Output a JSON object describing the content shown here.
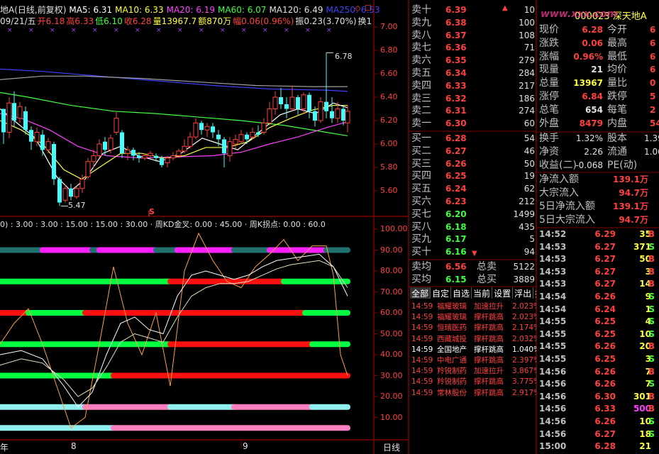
{
  "header": {
    "stock": "地A(日线,前复权)",
    "ma5": "MA5: 6.31",
    "ma10": "MA10: 6.33",
    "ma20": "MA20: 6.19",
    "ma60": "MA60: 6.07",
    "ma120": "MA120: 6.49",
    "ma250": "MA250: 6.53",
    "date": "09/21/五",
    "open": "开6.18",
    "high": "高6.33",
    "low": "低6.10",
    "close": "收6.28",
    "vol": "量13967.7",
    "amount": "额870万",
    "chg": "幅0.06(0.96%)",
    "amp": "振0.23(3.70%)",
    "turn": "换1"
  },
  "price_axis": [
    "7.00",
    "6.80",
    "6.60",
    "6.40",
    "6.20",
    "6.00",
    "5.80",
    "5.60"
  ],
  "price_marks": {
    "high_label": "6.78",
    "low_label": "5.47",
    "s_marker": "S"
  },
  "indicator_header": "0) : 3.00 : 3.00 : 15.00 : 15.00 : 30.00 · 周KD金叉: 0.00 : 45.00 · 周K拐点: 0.00 : 60.0",
  "ind_axis": [
    "100.00",
    "90.00",
    "80.00",
    "70.00",
    "60.00",
    "50.00",
    "40.00",
    "30.00",
    "20.00",
    "10.00"
  ],
  "bottom_bar": {
    "m1": "年",
    "m2": "8",
    "m3": "9",
    "period": "日线"
  },
  "orderbook": {
    "asks": [
      {
        "label": "卖十",
        "price": "6.39",
        "vol": "10"
      },
      {
        "label": "卖九",
        "price": "6.38",
        "vol": "100"
      },
      {
        "label": "卖八",
        "price": "6.37",
        "vol": "108"
      },
      {
        "label": "卖七",
        "price": "6.36",
        "vol": "71"
      },
      {
        "label": "卖六",
        "price": "6.35",
        "vol": "279"
      },
      {
        "label": "卖五",
        "price": "6.34",
        "vol": "284"
      },
      {
        "label": "卖四",
        "price": "6.33",
        "vol": "217"
      },
      {
        "label": "卖三",
        "price": "6.32",
        "vol": "186"
      },
      {
        "label": "卖二",
        "price": "6.31",
        "vol": "274"
      },
      {
        "label": "卖一",
        "price": "6.30",
        "vol": "60"
      }
    ],
    "bids": [
      {
        "label": "买一",
        "price": "6.28",
        "vol": "54"
      },
      {
        "label": "买二",
        "price": "6.27",
        "vol": "46"
      },
      {
        "label": "买三",
        "price": "6.26",
        "vol": "50"
      },
      {
        "label": "买四",
        "price": "6.25",
        "vol": "19"
      },
      {
        "label": "买五",
        "price": "6.24",
        "vol": "62"
      },
      {
        "label": "买六",
        "price": "6.23",
        "vol": "212"
      },
      {
        "label": "买七",
        "price": "6.20",
        "vol": "1499"
      },
      {
        "label": "买八",
        "price": "6.18",
        "vol": "435"
      },
      {
        "label": "买九",
        "price": "6.17",
        "vol": "5"
      },
      {
        "label": "买十",
        "price": "6.16",
        "vol": "94"
      }
    ],
    "avg_ask": {
      "label": "卖均",
      "price": "6.56",
      "tlabel": "总卖",
      "total": "5122"
    },
    "avg_bid": {
      "label": "买均",
      "price": "6.15",
      "tlabel": "总买",
      "total": "3889"
    }
  },
  "tabs": [
    "全部",
    "自定",
    "自选",
    "当前",
    "设置",
    "浮出",
    "执"
  ],
  "news": [
    {
      "time": "14:59",
      "name": "福耀玻璃",
      "sig": "加速拉升",
      "val": "2.023%",
      "color": "#ff4040"
    },
    {
      "time": "14:59",
      "name": "福耀玻璃",
      "sig": "撑杆跳高",
      "val": "2.023%",
      "color": "#ff4040"
    },
    {
      "time": "14:59",
      "name": "恒瑞医药",
      "sig": "撑杆跳高",
      "val": "2.174%",
      "color": "#ff4040"
    },
    {
      "time": "14:59",
      "name": "西藏城投",
      "sig": "撑杆跳高",
      "val": "2.032%",
      "color": "#ff4040"
    },
    {
      "time": "14:59",
      "name": "全国地产",
      "sig": "撑杆跳高",
      "val": "1.040%",
      "color": "#ffffff"
    },
    {
      "time": "14:59",
      "name": "中电广通",
      "sig": "撑杆跳高",
      "val": "2.397%",
      "color": "#ff4040"
    },
    {
      "time": "14:59",
      "name": "羚锐制药",
      "sig": "加速拉升",
      "val": "3.867%",
      "color": "#ff4040"
    },
    {
      "time": "14:59",
      "name": "羚锐制药",
      "sig": "撑杆跳高",
      "val": "3.775%",
      "color": "#ff4040"
    },
    {
      "time": "14:59",
      "name": "常林股份",
      "sig": "撑杆跳高",
      "val": "2.917%",
      "color": "#ff4040"
    }
  ],
  "stock_title": "000023 深天地A",
  "watermark": "www.xxx.com",
  "quote": [
    {
      "k1": "现价",
      "v1": "6.28",
      "c1": "#ff4040",
      "k2": "今开",
      "v2": "6"
    },
    {
      "k1": "涨跌",
      "v1": "0.06",
      "c1": "#ff4040",
      "k2": "最高",
      "v2": "6"
    },
    {
      "k1": "涨幅",
      "v1": "0.96%",
      "c1": "#ff4040",
      "k2": "最低",
      "v2": "6"
    },
    {
      "k1": "现量",
      "v1": "21",
      "c1": "#e0e0e0",
      "k2": "均价",
      "v2": "6"
    },
    {
      "k1": "总量",
      "v1": "13967",
      "c1": "#ffff40",
      "k2": "量比",
      "v2": "0"
    },
    {
      "k1": "涨停",
      "v1": "6.84",
      "c1": "#ff4040",
      "k2": "跌停",
      "v2": "5"
    },
    {
      "k1": "总笔",
      "v1": "654",
      "c1": "#e0e0e0",
      "k2": "每笔",
      "v2": "2"
    },
    {
      "k1": "外盘",
      "v1": "8479",
      "c1": "#ff4040",
      "k2": "内盘",
      "v2": "54"
    }
  ],
  "quote2": [
    {
      "k1": "换手",
      "v1": "1.32%",
      "k2": "股本",
      "v2": "1.39"
    },
    {
      "k1": "净资",
      "v1": "2.26",
      "k2": "流通",
      "v2": "1.06"
    },
    {
      "k1": "收益(二)",
      "v1": "-0.068",
      "k2": "PE(动)",
      "v2": ""
    }
  ],
  "flow": [
    {
      "k": "净流入额",
      "v": "139.1万"
    },
    {
      "k": "大宗流入",
      "v": "94.7万"
    },
    {
      "k": "5日净流入额",
      "v": "139.1万"
    },
    {
      "k": "5日大宗流入",
      "v": "94.7万"
    }
  ],
  "ticks": [
    {
      "t": "14:52",
      "p": "6.29",
      "v": "35",
      "bs": "B",
      "pc": "#ff4040",
      "vc": "#ffff40",
      "bc": "#ff4040"
    },
    {
      "t": "14:53",
      "p": "6.27",
      "v": "371",
      "bs": "S",
      "pc": "#ff4040",
      "vc": "#ffff40",
      "bc": "#40ff40"
    },
    {
      "t": "14:53",
      "p": "6.27",
      "v": "50",
      "bs": "B",
      "pc": "#ff4040",
      "vc": "#ffff40",
      "bc": "#ff4040"
    },
    {
      "t": "14:53",
      "p": "6.27",
      "v": "3",
      "bs": "B",
      "pc": "#ff4040",
      "vc": "#ffff40",
      "bc": "#ff4040"
    },
    {
      "t": "14:53",
      "p": "6.27",
      "v": "14",
      "bs": "B",
      "pc": "#ff4040",
      "vc": "#ffff40",
      "bc": "#ff4040"
    },
    {
      "t": "14:54",
      "p": "6.26",
      "v": "9",
      "bs": "S",
      "pc": "#ff4040",
      "vc": "#ffff40",
      "bc": "#40ff40"
    },
    {
      "t": "14:54",
      "p": "6.24",
      "v": "1",
      "bs": "S",
      "pc": "#ff4040",
      "vc": "#ffff40",
      "bc": "#40ff40"
    },
    {
      "t": "14:55",
      "p": "6.25",
      "v": "4",
      "bs": "S",
      "pc": "#ff4040",
      "vc": "#ffff40",
      "bc": "#40ff40"
    },
    {
      "t": "14:55",
      "p": "6.25",
      "v": "10",
      "bs": "S",
      "pc": "#ff4040",
      "vc": "#ffff40",
      "bc": "#40ff40"
    },
    {
      "t": "14:55",
      "p": "6.26",
      "v": "20",
      "bs": "B",
      "pc": "#ff4040",
      "vc": "#ffff40",
      "bc": "#ff4040"
    },
    {
      "t": "14:55",
      "p": "6.25",
      "v": "3",
      "bs": "S",
      "pc": "#ff4040",
      "vc": "#ffff40",
      "bc": "#40ff40"
    },
    {
      "t": "14:56",
      "p": "6.26",
      "v": "7",
      "bs": "B",
      "pc": "#ff4040",
      "vc": "#ffff40",
      "bc": "#ff4040"
    },
    {
      "t": "14:56",
      "p": "6.26",
      "v": "7",
      "bs": "S",
      "pc": "#ff4040",
      "vc": "#ffff40",
      "bc": "#40ff40"
    },
    {
      "t": "14:56",
      "p": "6.30",
      "v": "301",
      "bs": "B",
      "pc": "#ff4040",
      "vc": "#ffff40",
      "bc": "#ff4040"
    },
    {
      "t": "14:56",
      "p": "6.33",
      "v": "500",
      "bs": "B",
      "pc": "#ff4040",
      "vc": "#ff40ff",
      "bc": "#ff4040"
    },
    {
      "t": "14:56",
      "p": "6.26",
      "v": "10",
      "bs": "S",
      "pc": "#ff4040",
      "vc": "#ffff40",
      "bc": "#40ff40"
    },
    {
      "t": "14:56",
      "p": "6.27",
      "v": "18",
      "bs": "S",
      "pc": "#ff4040",
      "vc": "#ffff40",
      "bc": "#40ff40"
    },
    {
      "t": "15:00",
      "p": "6.28",
      "v": "21",
      "bs": "",
      "pc": "#ff4040",
      "vc": "#ffff40",
      "bc": "#40ff40"
    }
  ],
  "colors": {
    "up": "#ff4040",
    "down": "#40ffff",
    "ma5": "#ffffff",
    "ma10": "#ffff40",
    "ma20": "#ff40ff",
    "ma60": "#40ff40",
    "ma120": "#a0a0a0",
    "ma250": "#4040ff",
    "grid": "#800000"
  }
}
